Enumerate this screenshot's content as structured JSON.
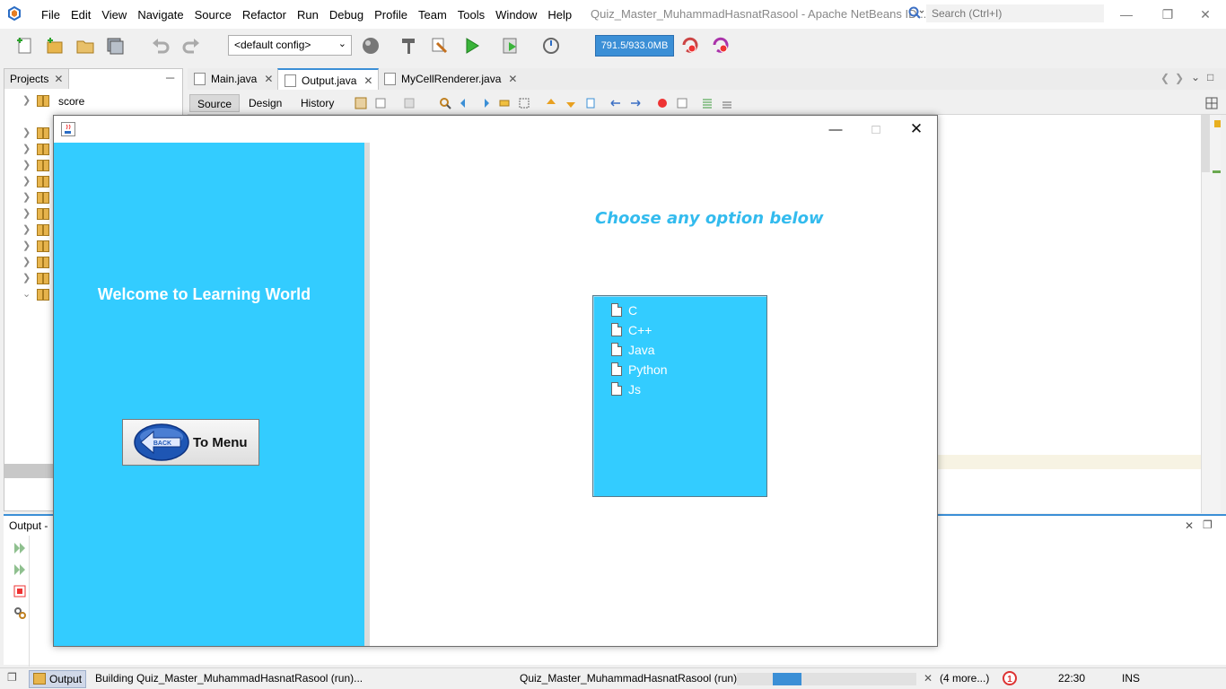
{
  "ide": {
    "menu": [
      "File",
      "Edit",
      "View",
      "Navigate",
      "Source",
      "Refactor",
      "Run",
      "Debug",
      "Profile",
      "Team",
      "Tools",
      "Window",
      "Help"
    ],
    "title": "Quiz_Master_MuhammadHasnatRasool - Apache NetBeans ID...",
    "search_placeholder": "Search (Ctrl+I)",
    "config": "<default config>",
    "memory": "791.5/933.0MB",
    "projects_tab": "Projects",
    "tree_first": "score",
    "tabs": [
      "Main.java",
      "Output.java",
      "MyCellRenderer.java"
    ],
    "sub_tabs": [
      "Source",
      "Design",
      "History"
    ],
    "output_tab": "Output -",
    "status": {
      "output_label": "Output",
      "building": "Building Quiz_Master_MuhammadHasnatRasool (run)...",
      "project_run": "Quiz_Master_MuhammadHasnatRasool (run)",
      "more": "(4 more...)",
      "position": "22:30",
      "mode": "INS"
    }
  },
  "app": {
    "welcome": "Welcome to Learning World",
    "back_button": "To Menu",
    "back_icon_text": "BACK",
    "heading": "Choose any option below",
    "languages": [
      "C",
      "C++",
      "Java",
      "Python",
      "Js"
    ]
  },
  "colors": {
    "panel": "#33ccff",
    "heading": "#33bbee",
    "accent": "#3b8fd6"
  },
  "progress": 0.16
}
